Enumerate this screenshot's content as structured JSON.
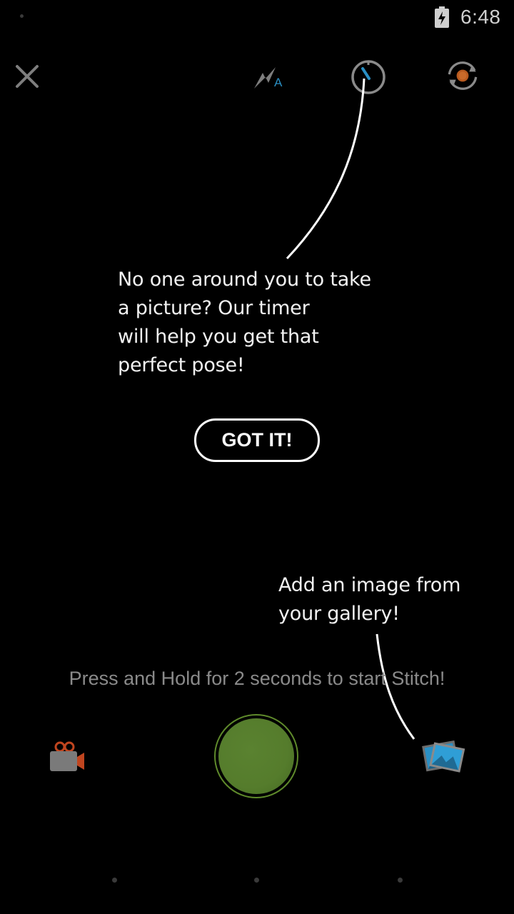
{
  "status_bar": {
    "time": "6:48",
    "battery_icon": "battery-charging-icon"
  },
  "toolbar": {
    "close_icon": "close-icon",
    "flash_icon": "flash-auto-icon",
    "flash_mode_label": "A",
    "timer_icon": "timer-icon",
    "switch_camera_icon": "switch-camera-icon"
  },
  "coachmarks": {
    "timer_tip": {
      "lines": [
        "No one around you to take",
        "a picture? Our timer",
        "will help you get that",
        "perfect pose!"
      ]
    },
    "got_it_label": "GOT IT!",
    "gallery_tip": {
      "lines": [
        "Add an image from",
        "your gallery!"
      ]
    }
  },
  "hint_text": "Press and Hold for 2 seconds to start Stitch!",
  "bottom_bar": {
    "video_icon": "video-camera-icon",
    "shutter_icon": "shutter-button",
    "gallery_icon": "gallery-icon"
  },
  "colors": {
    "background": "#000000",
    "shutter_green": "#557c2c",
    "timer_accent": "#2a8fc4",
    "video_accent": "#c0451f",
    "gallery_accent": "#2a8fc4",
    "hint_text": "#8a8a8a"
  }
}
